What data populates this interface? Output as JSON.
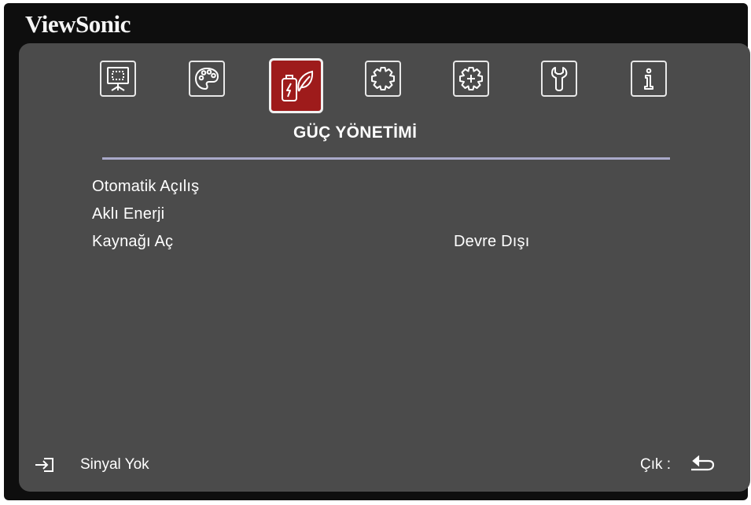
{
  "brand": {
    "name": "ViewSonic"
  },
  "tabs": [
    {
      "icon": "display-icon",
      "active": false
    },
    {
      "icon": "palette-icon",
      "active": false
    },
    {
      "icon": "power-leaf-icon",
      "active": true
    },
    {
      "icon": "gear-icon",
      "active": false
    },
    {
      "icon": "advanced-gear-icon",
      "active": false
    },
    {
      "icon": "wrench-icon",
      "active": false
    },
    {
      "icon": "info-icon",
      "active": false
    }
  ],
  "menu": {
    "title": "GÜÇ YÖNETİMİ",
    "items": [
      {
        "label": "Otomatik Açılış",
        "value": ""
      },
      {
        "label": "Aklı Enerji",
        "value": ""
      },
      {
        "label": "Kaynağı Aç",
        "value": "Devre Dışı"
      }
    ]
  },
  "footer": {
    "status_icon": "input-source-icon",
    "status_text": "Sinyal Yok",
    "exit_label": "Çık :",
    "exit_icon": "return-arrow-icon"
  },
  "colors": {
    "panel": "#4b4b4b",
    "frame": "#0e0e0e",
    "active_tab": "#9e1b1b",
    "divider": "#a9a9c9"
  }
}
